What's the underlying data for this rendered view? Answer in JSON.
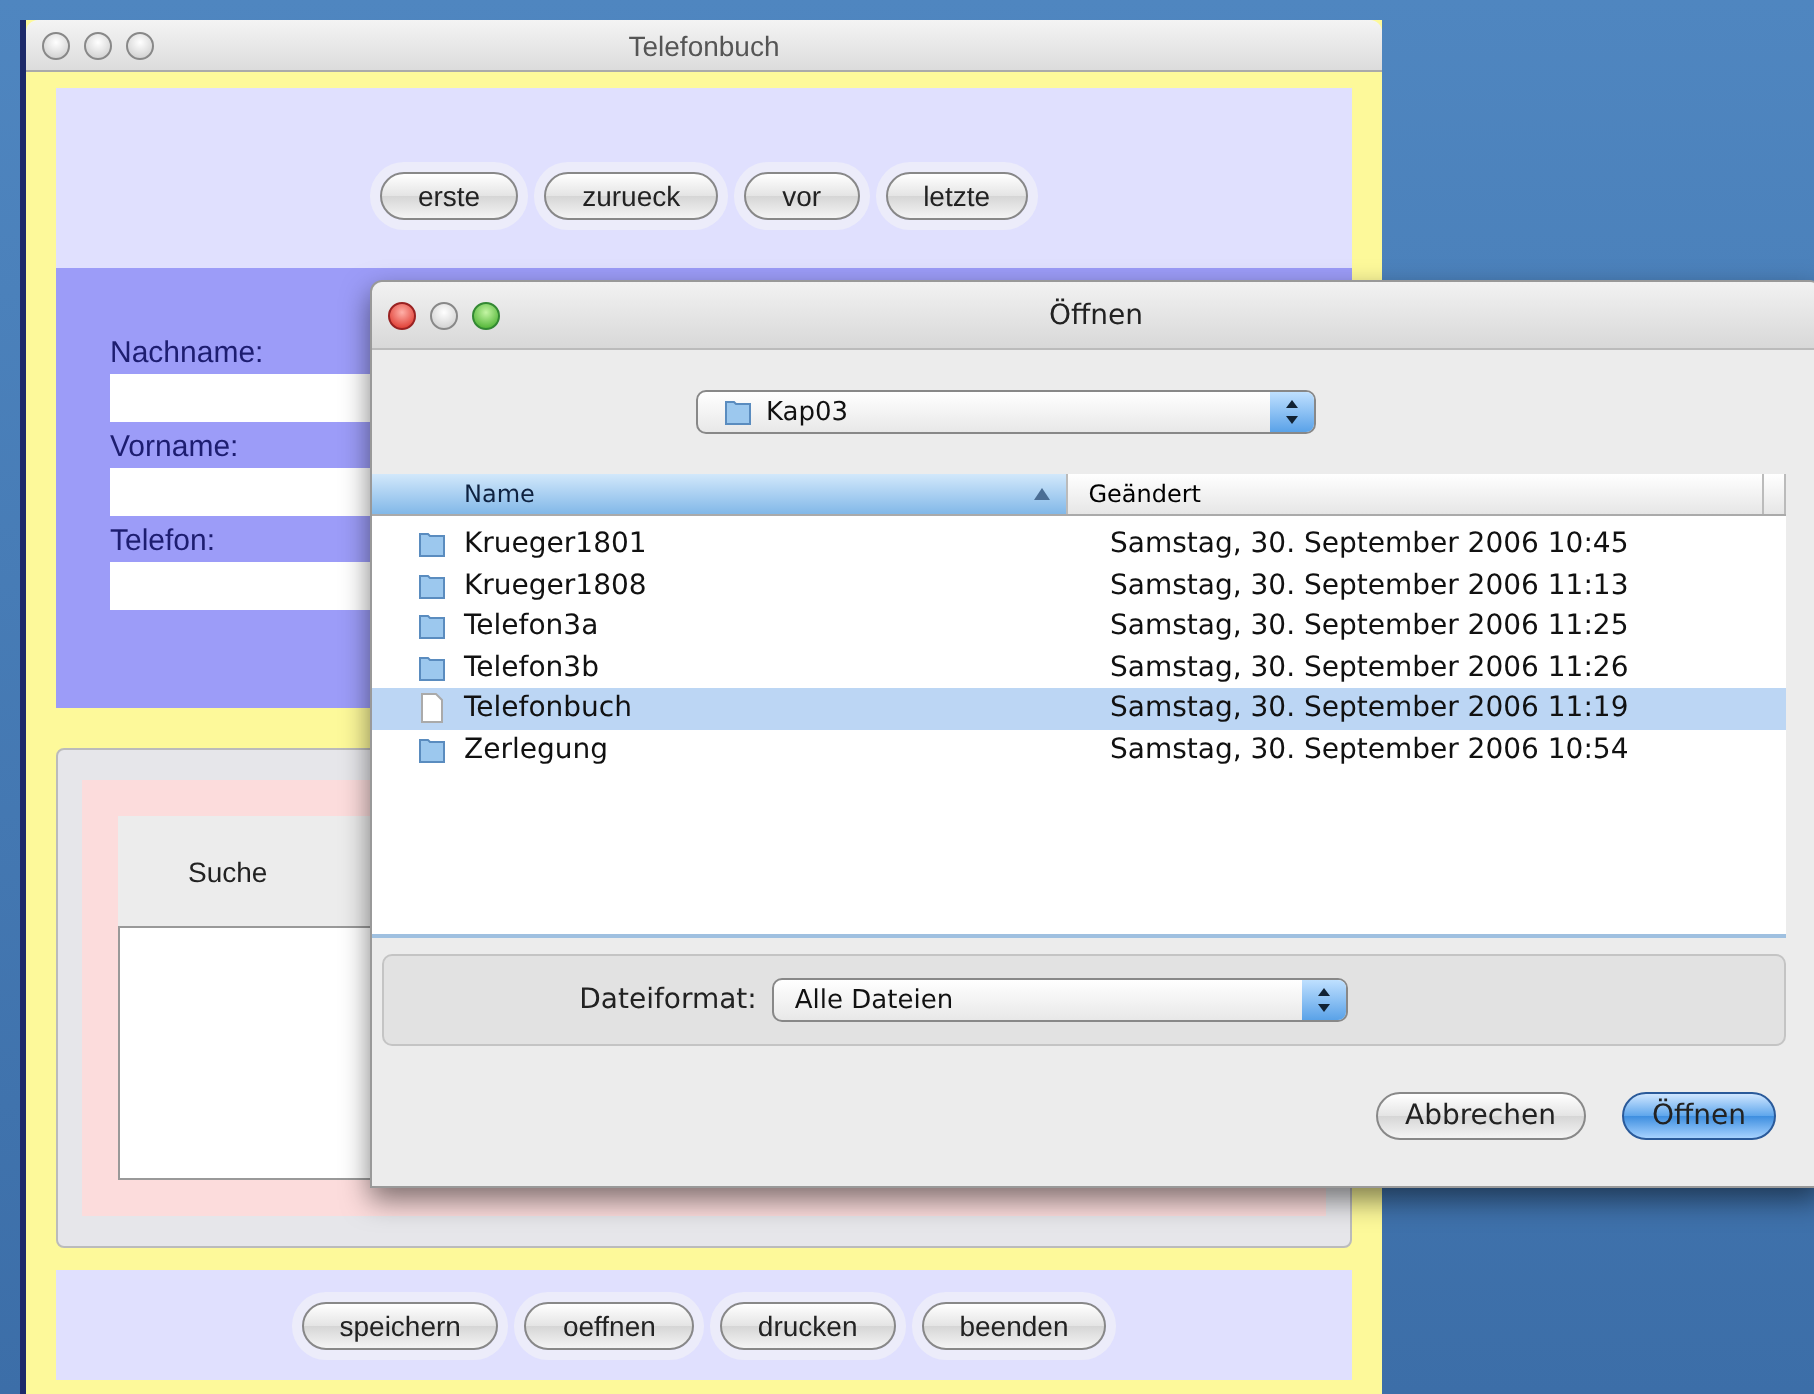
{
  "window": {
    "title": "Telefonbuch"
  },
  "nav_buttons": [
    "erste",
    "zurueck",
    "vor",
    "letzte"
  ],
  "form_fields": [
    {
      "label": "Nachname:"
    },
    {
      "label": "Vorname:"
    },
    {
      "label": "Telefon:"
    }
  ],
  "search_label": "Suche",
  "bottom_buttons": [
    "speichern",
    "oeffnen",
    "drucken",
    "beenden"
  ],
  "dialog": {
    "title": "Öffnen",
    "folder": "Kap03",
    "columns": [
      {
        "label": "Name",
        "sorted": true
      },
      {
        "label": "Geändert",
        "sorted": false
      }
    ],
    "files": [
      {
        "name": "Krueger1801",
        "kind": "folder",
        "modified": "Samstag, 30. September 2006 10:45",
        "selected": false
      },
      {
        "name": "Krueger1808",
        "kind": "folder",
        "modified": "Samstag, 30. September 2006 11:13",
        "selected": false
      },
      {
        "name": "Telefon3a",
        "kind": "folder",
        "modified": "Samstag, 30. September 2006 11:25",
        "selected": false
      },
      {
        "name": "Telefon3b",
        "kind": "folder",
        "modified": "Samstag, 30. September 2006 11:26",
        "selected": false
      },
      {
        "name": "Telefonbuch",
        "kind": "file",
        "modified": "Samstag, 30. September 2006 11:19",
        "selected": true
      },
      {
        "name": "Zerlegung",
        "kind": "folder",
        "modified": "Samstag, 30. September 2006 10:54",
        "selected": false
      }
    ],
    "format_label": "Dateiformat:",
    "format_value": "Alle Dateien",
    "buttons": [
      {
        "label": "Abbrechen",
        "default": false
      },
      {
        "label": "Öffnen",
        "default": true
      }
    ]
  }
}
